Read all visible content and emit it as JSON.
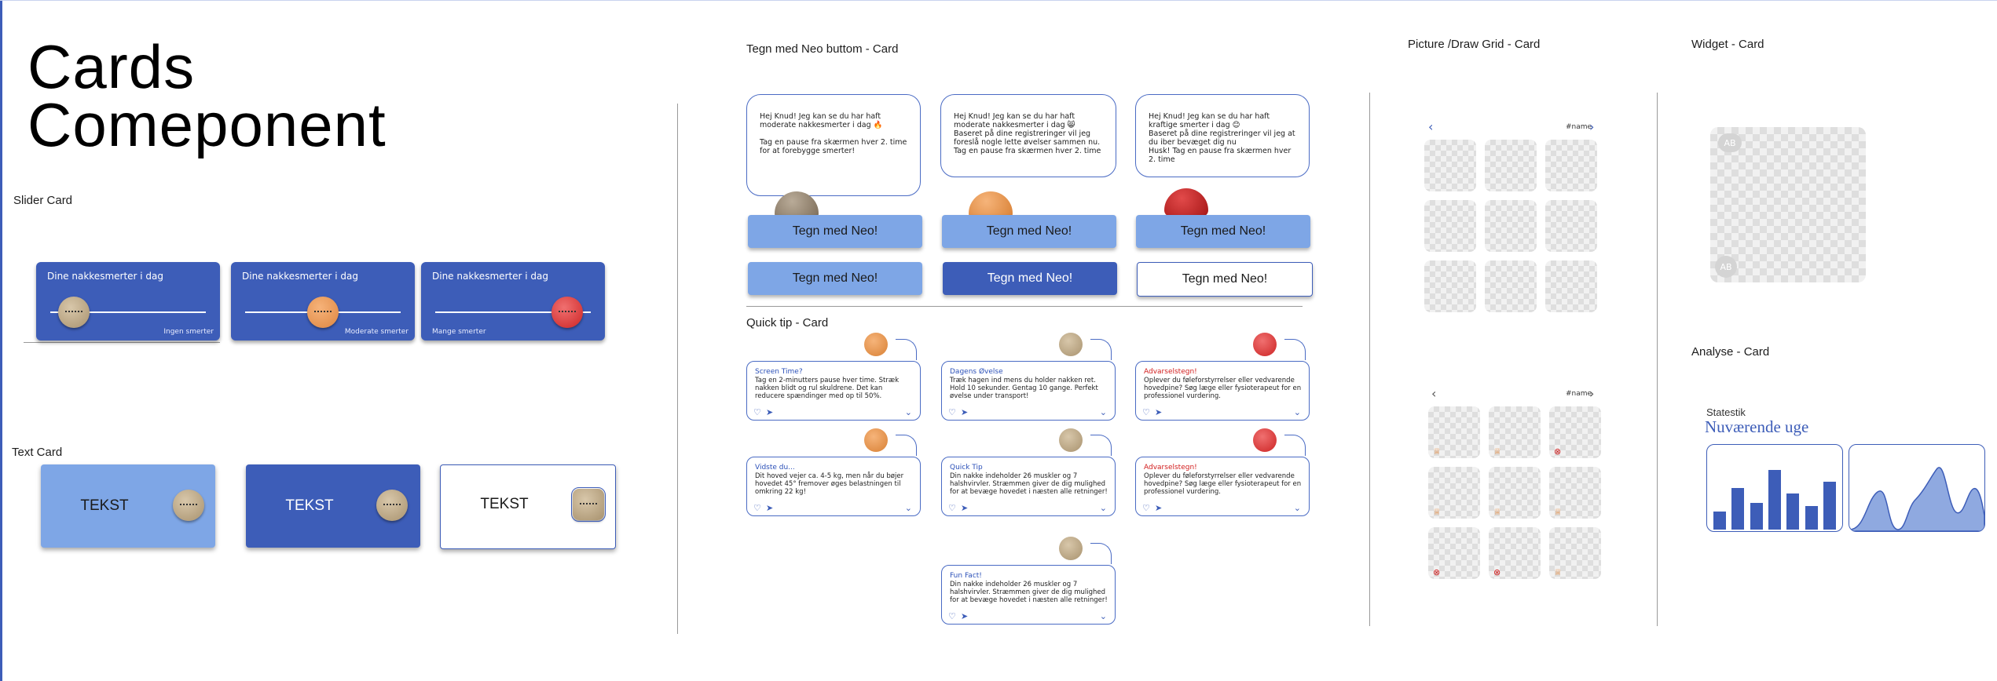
{
  "title": {
    "line1": "Cards",
    "line2": "Comeponent"
  },
  "sections": {
    "slider": "Slider Card",
    "text": "Text Card",
    "neo": "Tegn med Neo buttom - Card",
    "quick_tip": "Quick tip - Card",
    "grid": "Picture /Draw Grid - Card",
    "widget": "Widget - Card",
    "analyse": "Analyse - Card"
  },
  "slider_cards": [
    {
      "title": "Dine nakkesmerter i dag",
      "caption": "Ingen smerter",
      "level": 0.15,
      "color": "tan"
    },
    {
      "title": "Dine nakkesmerter i dag",
      "caption": "Moderate smerter",
      "level": 0.5,
      "color": "orange"
    },
    {
      "title": "Dine nakkesmerter i dag",
      "caption": "Mange smerter",
      "level": 0.85,
      "color": "red"
    }
  ],
  "text_cards": [
    {
      "label": "TEKST",
      "style": "light"
    },
    {
      "label": "TEKST",
      "style": "dark"
    },
    {
      "label": "TEKST",
      "style": "white"
    }
  ],
  "neo_bubbles": [
    {
      "text": "Hej Knud! Jeg kan se du har haft moderate nakkesmerter i dag 🔥\n\nTag en pause fra skærmen hver 2. time for at forebygge smerter!",
      "blob": "tan"
    },
    {
      "text": "Hej Knud! Jeg kan se du har haft moderate nakkesmerter i dag 😸\nBaseret på dine registreringer vil jeg foreslå nogle lette øvelser sammen nu.\nTag en pause fra skærmen hver 2. time",
      "blob": "orange"
    },
    {
      "text": "Hej Knud! Jeg kan se du har haft kraftige smerter i dag 😊\nBaseret på dine registreringer vil jeg at du iber bevæget dig nu\nHusk! Tag en pause fra skærmen hver 2. time",
      "blob": "red"
    }
  ],
  "neo_button_label": "Tegn med Neo!",
  "tips": [
    {
      "title": "Screen Time?",
      "body": "Tag en 2-minutters pause hver time. Stræk nakken blidt og rul skuldrene. Det kan reducere spændinger med op til 50%.",
      "knob": "orange",
      "title_color": "blue"
    },
    {
      "title": "Dagens Øvelse",
      "body": "Træk hagen ind mens du holder nakken ret. Hold 10 sekunder. Gentag 10 gange. Perfekt øvelse under transport!",
      "knob": "tan",
      "title_color": "blue"
    },
    {
      "title": "Advarselstegn!",
      "body": "Oplever du føleforstyrrelser eller vedvarende hovedpine? Søg læge eller fysioterapeut for en professionel vurdering.",
      "knob": "red",
      "title_color": "red"
    },
    {
      "title": "Vidste du...",
      "body": "Dit hoved vejer ca. 4-5 kg, men når du bøjer hovedet 45° fremover øges belastningen til omkring 22 kg!",
      "knob": "orange",
      "title_color": "blue"
    },
    {
      "title": "Quick Tip",
      "body": "Din nakke indeholder 26 muskler og 7 halshvirvler. Stræmmen giver de dig mulighed for at bevæge hovedet i næsten alle retninger!",
      "knob": "tan",
      "title_color": "blue"
    },
    {
      "title": "Advarselstegn!",
      "body": "Oplever du føleforstyrrelser eller vedvarende hovedpine? Søg læge eller fysioterapeut for en professionel vurdering.",
      "knob": "red",
      "title_color": "red"
    },
    {
      "title": "Fun Fact!",
      "body": "Din nakke indeholder 26 muskler og 7 halshvirvler. Stræmmen giver de dig mulighed for at bevæge hovedet i næsten alle retninger!",
      "knob": "tan",
      "title_color": "blue"
    }
  ],
  "grid": {
    "prev": "‹",
    "next": "›",
    "name": "#name"
  },
  "grid_markers": [
    "trophy",
    "trophy",
    "x",
    "trophy",
    "trophy",
    "trophy",
    "x",
    "x",
    "trophy"
  ],
  "widget": {
    "chip1": "AB",
    "chip2": "AB"
  },
  "analyse": {
    "label": "Statestik",
    "title": "Nuværende uge",
    "bars": [
      0.3,
      0.7,
      0.45,
      1.0,
      0.6,
      0.4,
      0.8
    ]
  },
  "colors": {
    "primary": "#3d5db8",
    "light": "#7ea6e6",
    "warn": "#d21d1d",
    "orange": "#e8914a"
  }
}
